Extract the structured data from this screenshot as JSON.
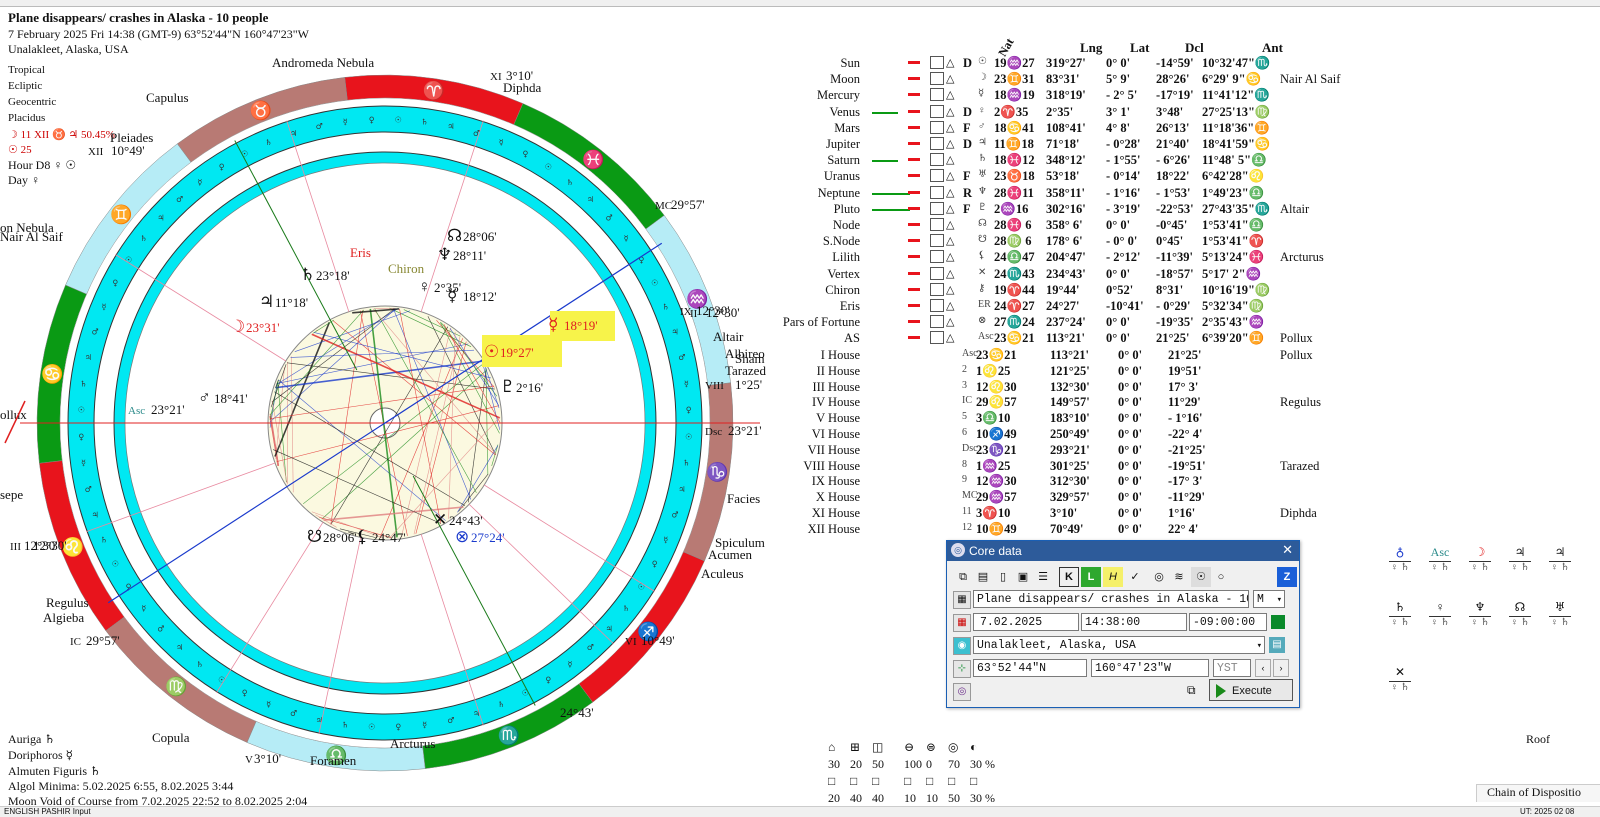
{
  "header": {
    "title": "Plane disappears/ crashes in Alaska - 10 people",
    "line2": "7 February 2025  Fri  14:38 (GMT-9) 63°52'44\"N  160°47'23\"W",
    "line3": "Unalakleet, Alaska, USA"
  },
  "settings": [
    "Tropical",
    "Ecliptic",
    "Geocentric",
    "Placidus",
    "☽  11 XII ♉ ♃ 50.45%",
    "☉  25",
    "Hour D8 ♀ ☉",
    "Day ♀"
  ],
  "bottom_info": {
    "auriga": "Auriga  ♄",
    "doriphoros": "Doriphoros  ☿",
    "almuten": "Almuten Figuris  ♄",
    "algol": "Algol Minima: 5.02.2025  6:55,  8.02.2025  3:44",
    "moon_void": "Moon Void of Course from 7.02.2025 22:52 to 8.02.2025  2:04"
  },
  "chart": {
    "house_cusps": [
      {
        "label": "Asc",
        "deg": "23°21'",
        "color": "#2a8a8a"
      },
      {
        "label": "MC",
        "deg": "29°57'"
      },
      {
        "label": "XI",
        "deg": "3°10'"
      },
      {
        "label": "XII",
        "deg": "10°49'"
      },
      {
        "label": "II",
        "deg": "12°30'"
      },
      {
        "label": "III",
        "deg": "12°30'"
      },
      {
        "label": "IC",
        "deg": "29°57'"
      },
      {
        "label": "V",
        "deg": "3°10'"
      },
      {
        "label": "VI",
        "deg": "10°49'"
      },
      {
        "label": "VIII",
        "deg": "1°25'"
      },
      {
        "label": "Dsc",
        "deg": "23°21'"
      },
      {
        "label": "IX",
        "deg": "12°30'"
      }
    ],
    "planet_labels": [
      {
        "glyph": "☽",
        "deg": "23°31'",
        "color": "#e02020"
      },
      {
        "glyph": "♃",
        "deg": "11°18'",
        "color": "#111"
      },
      {
        "glyph": "♄",
        "deg": "23°18'",
        "color": "#111"
      },
      {
        "glyph": "Eris",
        "deg": "",
        "color": "#e02020"
      },
      {
        "glyph": "Chiron",
        "deg": "",
        "color": "#888833"
      },
      {
        "glyph": "♀",
        "deg": "2°35'",
        "color": "#111"
      },
      {
        "glyph": "♆",
        "deg": "28°11'",
        "color": "#111"
      },
      {
        "glyph": "☊",
        "deg": "28°06'",
        "color": "#111"
      },
      {
        "glyph": "☿",
        "deg": "18°12'",
        "color": "#111"
      },
      {
        "glyph": "☿",
        "deg": "18°19'",
        "color": "#e02020"
      },
      {
        "glyph": "☉",
        "deg": "19°27'",
        "color": "#e02020"
      },
      {
        "glyph": "♇",
        "deg": "2°16'",
        "color": "#111"
      },
      {
        "glyph": "♂",
        "deg": "18°41'",
        "color": "#111"
      },
      {
        "glyph": "☋",
        "deg": "28°06'",
        "color": "#111"
      },
      {
        "glyph": "⚸",
        "deg": "24°47'",
        "color": "#111"
      },
      {
        "glyph": "✕",
        "deg": "24°43'",
        "color": "#111"
      },
      {
        "glyph": "⊗",
        "deg": "27°24'",
        "color": "#1a3acc"
      }
    ],
    "fixed_stars": [
      "Andromeda Nebula",
      "Capulus",
      "Pleiades",
      "Diphda",
      "Altair",
      "Albireo",
      "Sham",
      "Tarazed",
      "Facies",
      "Spiculum",
      "Acumen",
      "Aculeus",
      "Regulus",
      "Algieba",
      "Copula",
      "Arcturus",
      "Foramen",
      "on Nebula",
      "Nair Al Saif",
      "ollux",
      "sepe"
    ],
    "outer_degs": [
      "24°43'",
      "24°43'",
      "12°30'"
    ]
  },
  "planet_table": {
    "headers": [
      "Nat",
      "Lng",
      "Lat",
      "Dcl",
      "Ant"
    ],
    "rows": [
      {
        "name": "Sun",
        "flag": "D",
        "glyph": "☉",
        "pos": "19♒27",
        "lng": "319°27'",
        "lat": "0° 0'",
        "dcl": "-14°59'",
        "ant": "10°32'47\"♏",
        "star": ""
      },
      {
        "name": "Moon",
        "flag": "",
        "glyph": "☽",
        "pos": "23♊31",
        "lng": "83°31'",
        "lat": "5° 9'",
        "dcl": "28°26'",
        "ant": "6°29' 9\"♋",
        "star": "Nair Al Saif"
      },
      {
        "name": "Mercury",
        "flag": "",
        "glyph": "☿",
        "pos": "18♒19",
        "lng": "318°19'",
        "lat": "- 2° 5'",
        "dcl": "-17°19'",
        "ant": "11°41'12\"♏",
        "star": ""
      },
      {
        "name": "Venus",
        "flag": "D",
        "glyph": "♀",
        "pos": "2♈35",
        "lng": "2°35'",
        "lat": "3° 1'",
        "dcl": "3°48'",
        "ant": "27°25'13\"♍",
        "star": ""
      },
      {
        "name": "Mars",
        "flag": "F",
        "glyph": "♂",
        "pos": "18♋41",
        "lng": "108°41'",
        "lat": "4° 8'",
        "dcl": "26°13'",
        "ant": "11°18'36\"♊",
        "star": ""
      },
      {
        "name": "Jupiter",
        "flag": "D",
        "glyph": "♃",
        "pos": "11♊18",
        "lng": "71°18'",
        "lat": "- 0°28'",
        "dcl": "21°40'",
        "ant": "18°41'59\"♋",
        "star": ""
      },
      {
        "name": "Saturn",
        "flag": "",
        "glyph": "♄",
        "pos": "18♓12",
        "lng": "348°12'",
        "lat": "- 1°55'",
        "dcl": "- 6°26'",
        "ant": "11°48' 5\"♎",
        "star": ""
      },
      {
        "name": "Uranus",
        "flag": "F",
        "glyph": "♅",
        "pos": "23♉18",
        "lng": "53°18'",
        "lat": "- 0°14'",
        "dcl": "18°22'",
        "ant": "6°42'28\"♌",
        "star": ""
      },
      {
        "name": "Neptune",
        "flag": "R",
        "glyph": "♆",
        "pos": "28♓11",
        "lng": "358°11'",
        "lat": "- 1°16'",
        "dcl": "- 1°53'",
        "ant": "1°49'23\"♎",
        "star": ""
      },
      {
        "name": "Pluto",
        "flag": "F",
        "glyph": "♇",
        "pos": "2♒16",
        "lng": "302°16'",
        "lat": "- 3°19'",
        "dcl": "-22°53'",
        "ant": "27°43'35\"♏",
        "star": "Altair"
      },
      {
        "name": "Node",
        "flag": "",
        "glyph": "☊",
        "pos": "28♓ 6",
        "lng": "358° 6'",
        "lat": "0° 0'",
        "dcl": "-0°45'",
        "ant": "1°53'41\"♎",
        "star": ""
      },
      {
        "name": "S.Node",
        "flag": "",
        "glyph": "☋",
        "pos": "28♍ 6",
        "lng": "178° 6'",
        "lat": "- 0° 0'",
        "dcl": "0°45'",
        "ant": "1°53'41\"♈",
        "star": ""
      },
      {
        "name": "Lilith",
        "flag": "",
        "glyph": "⚸",
        "pos": "24♎47",
        "lng": "204°47'",
        "lat": "- 2°12'",
        "dcl": "-11°39'",
        "ant": "5°13'24\"♓",
        "star": "Arcturus"
      },
      {
        "name": "Vertex",
        "flag": "",
        "glyph": "✕",
        "pos": "24♏43",
        "lng": "234°43'",
        "lat": "0° 0'",
        "dcl": "-18°57'",
        "ant": "5°17' 2\"♒",
        "star": ""
      },
      {
        "name": "Chiron",
        "flag": "",
        "glyph": "⚷",
        "pos": "19♈44",
        "lng": "19°44'",
        "lat": "0°52'",
        "dcl": "8°31'",
        "ant": "10°16'19\"♍",
        "star": ""
      },
      {
        "name": "Eris",
        "flag": "",
        "glyph": "ER",
        "pos": "24♈27",
        "lng": "24°27'",
        "lat": "-10°41'",
        "dcl": "- 0°29'",
        "ant": "5°32'34\"♍",
        "star": ""
      },
      {
        "name": "Pars of Fortune",
        "flag": "",
        "glyph": "⊗",
        "pos": "27♏24",
        "lng": "237°24'",
        "lat": "0° 0'",
        "dcl": "-19°35'",
        "ant": "2°35'43\"♒",
        "star": ""
      },
      {
        "name": "AS",
        "flag": "",
        "glyph": "Asc",
        "pos": "23♋21",
        "lng": "113°21'",
        "lat": "0° 0'",
        "dcl": "21°25'",
        "ant": "6°39'20\"♊",
        "star": "Pollux"
      }
    ],
    "houses": [
      {
        "name": "I House",
        "glyph": "Asc",
        "pos": "23♋21",
        "lng": "113°21'",
        "lat": "0° 0'",
        "dcl": "21°25'",
        "star": "Pollux"
      },
      {
        "name": "II House",
        "glyph": "2",
        "pos": "1♌25",
        "lng": "121°25'",
        "lat": "0° 0'",
        "dcl": "19°51'",
        "star": ""
      },
      {
        "name": "III House",
        "glyph": "3",
        "pos": "12♌30",
        "lng": "132°30'",
        "lat": "0° 0'",
        "dcl": "17° 3'",
        "star": ""
      },
      {
        "name": "IV House",
        "glyph": "IC",
        "pos": "29♌57",
        "lng": "149°57'",
        "lat": "0° 0'",
        "dcl": "11°29'",
        "star": "Regulus"
      },
      {
        "name": "V House",
        "glyph": "5",
        "pos": "3♎10",
        "lng": "183°10'",
        "lat": "0° 0'",
        "dcl": "- 1°16'",
        "star": ""
      },
      {
        "name": "VI House",
        "glyph": "6",
        "pos": "10♐49",
        "lng": "250°49'",
        "lat": "0° 0'",
        "dcl": "-22° 4'",
        "star": ""
      },
      {
        "name": "VII House",
        "glyph": "Dsc",
        "pos": "23♑21",
        "lng": "293°21'",
        "lat": "0° 0'",
        "dcl": "-21°25'",
        "star": ""
      },
      {
        "name": "VIII House",
        "glyph": "8",
        "pos": "1♒25",
        "lng": "301°25'",
        "lat": "0° 0'",
        "dcl": "-19°51'",
        "star": "Tarazed"
      },
      {
        "name": "IX House",
        "glyph": "9",
        "pos": "12♒30",
        "lng": "312°30'",
        "lat": "0° 0'",
        "dcl": "-17° 3'",
        "star": ""
      },
      {
        "name": "X House",
        "glyph": "MC",
        "pos": "29♒57",
        "lng": "329°57'",
        "lat": "0° 0'",
        "dcl": "-11°29'",
        "star": ""
      },
      {
        "name": "XI House",
        "glyph": "11",
        "pos": "3♈10",
        "lng": "3°10'",
        "lat": "0° 0'",
        "dcl": "1°16'",
        "star": "Diphda"
      },
      {
        "name": "XII House",
        "glyph": "12",
        "pos": "10♊49",
        "lng": "70°49'",
        "lat": "0° 0'",
        "dcl": "22° 4'",
        "star": ""
      }
    ]
  },
  "core_data": {
    "title": "Core data",
    "name_value": "Plane disappears/ crashes in Alaska - 10",
    "gender": "M",
    "date": "7.02.2025",
    "time": "14:38:00",
    "zone": "-09:00:00",
    "place": "Unalakleet, Alaska, USA",
    "lat": "63°52'44\"N",
    "lon": "160°47'23\"W",
    "zone_abbr": "YST",
    "execute": "Execute"
  },
  "stats": {
    "row1": [
      "30",
      "20",
      "50",
      "100",
      "0",
      "70",
      "30 %"
    ],
    "row2": [
      "20",
      "40",
      "40",
      "10",
      "10",
      "50",
      "30 %"
    ]
  },
  "disposition": {
    "footer": "Chain of Dispositio",
    "roof": "Roof"
  },
  "status": {
    "left": "ENGLISH PASHIR Input",
    "right": "UT: 2025 02 08"
  },
  "colors": {
    "red": "#e8141c",
    "green": "#0a9a14",
    "rose": "#b87a74",
    "lightblue": "#b6ecf6",
    "cyan": "#00e8f2",
    "highlight": "#f7f34a"
  }
}
